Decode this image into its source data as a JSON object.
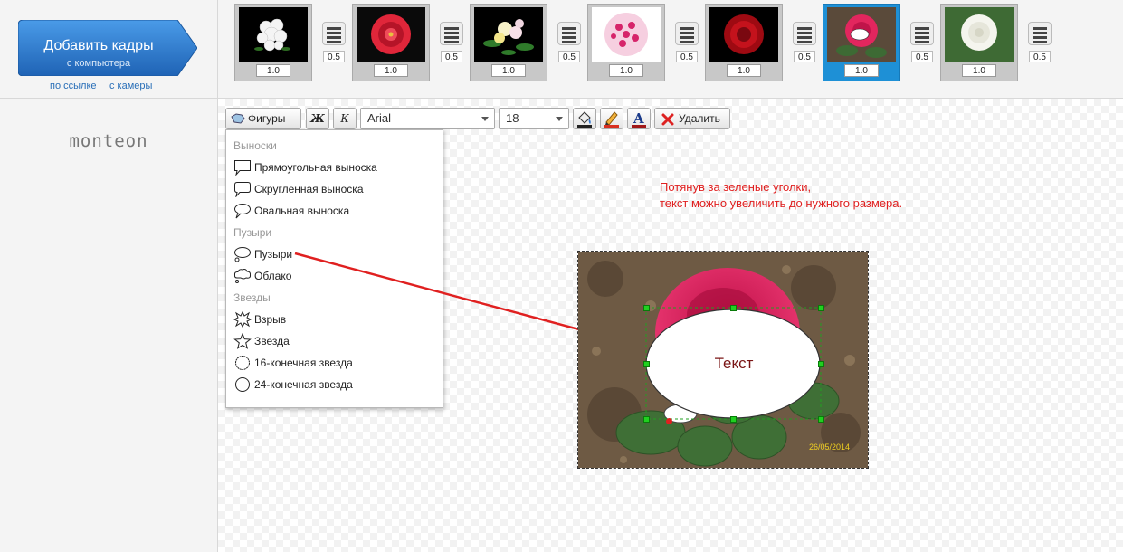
{
  "sidebar": {
    "add_button": {
      "title": "Добавить кадры",
      "subtitle": "с компьютера",
      "color": "#2e7bd0"
    },
    "links": {
      "by_url": "по ссылке",
      "from_camera": "с камеры"
    },
    "logo": "monteon"
  },
  "filmstrip": {
    "frames": [
      {
        "duration": "1.0",
        "flower": "white-flower-bouquet"
      },
      {
        "duration": "1.0",
        "flower": "red-dahlia"
      },
      {
        "duration": "1.0",
        "flower": "yellow-lily-bouquet"
      },
      {
        "duration": "1.0",
        "flower": "pink-carnation"
      },
      {
        "duration": "1.0",
        "flower": "red-ranunculus"
      },
      {
        "duration": "1.0",
        "flower": "pink-rose",
        "selected": true
      },
      {
        "duration": "1.0",
        "flower": "white-rose"
      }
    ],
    "transitions": [
      "0.5",
      "0.5",
      "0.5",
      "0.5",
      "0.5",
      "0.5",
      "0.5"
    ]
  },
  "toolbar": {
    "shapes_label": "Фигуры",
    "bold_label": "Ж",
    "italic_label": "К",
    "font": "Arial",
    "size": "18",
    "delete_label": "Удалить"
  },
  "shapes_menu": {
    "sections": [
      {
        "header": "Выноски",
        "items": [
          "Прямоугольная выноска",
          "Скругленная выноска",
          "Овальная выноска"
        ]
      },
      {
        "header": "Пузыри",
        "items": [
          "Пузыри",
          "Облако"
        ]
      },
      {
        "header": "Звезды",
        "items": [
          "Взрыв",
          "Звезда",
          "16-конечная звезда",
          "24-конечная звезда"
        ]
      }
    ]
  },
  "hint": {
    "line1": "Потянув за зеленые уголки,",
    "line2": "текст можно увеличить до нужного размера."
  },
  "canvas": {
    "bubble_text": "Текст",
    "date_stamp": "26/05/2014",
    "accent": "#e02020",
    "handle_color": "#20d020"
  }
}
